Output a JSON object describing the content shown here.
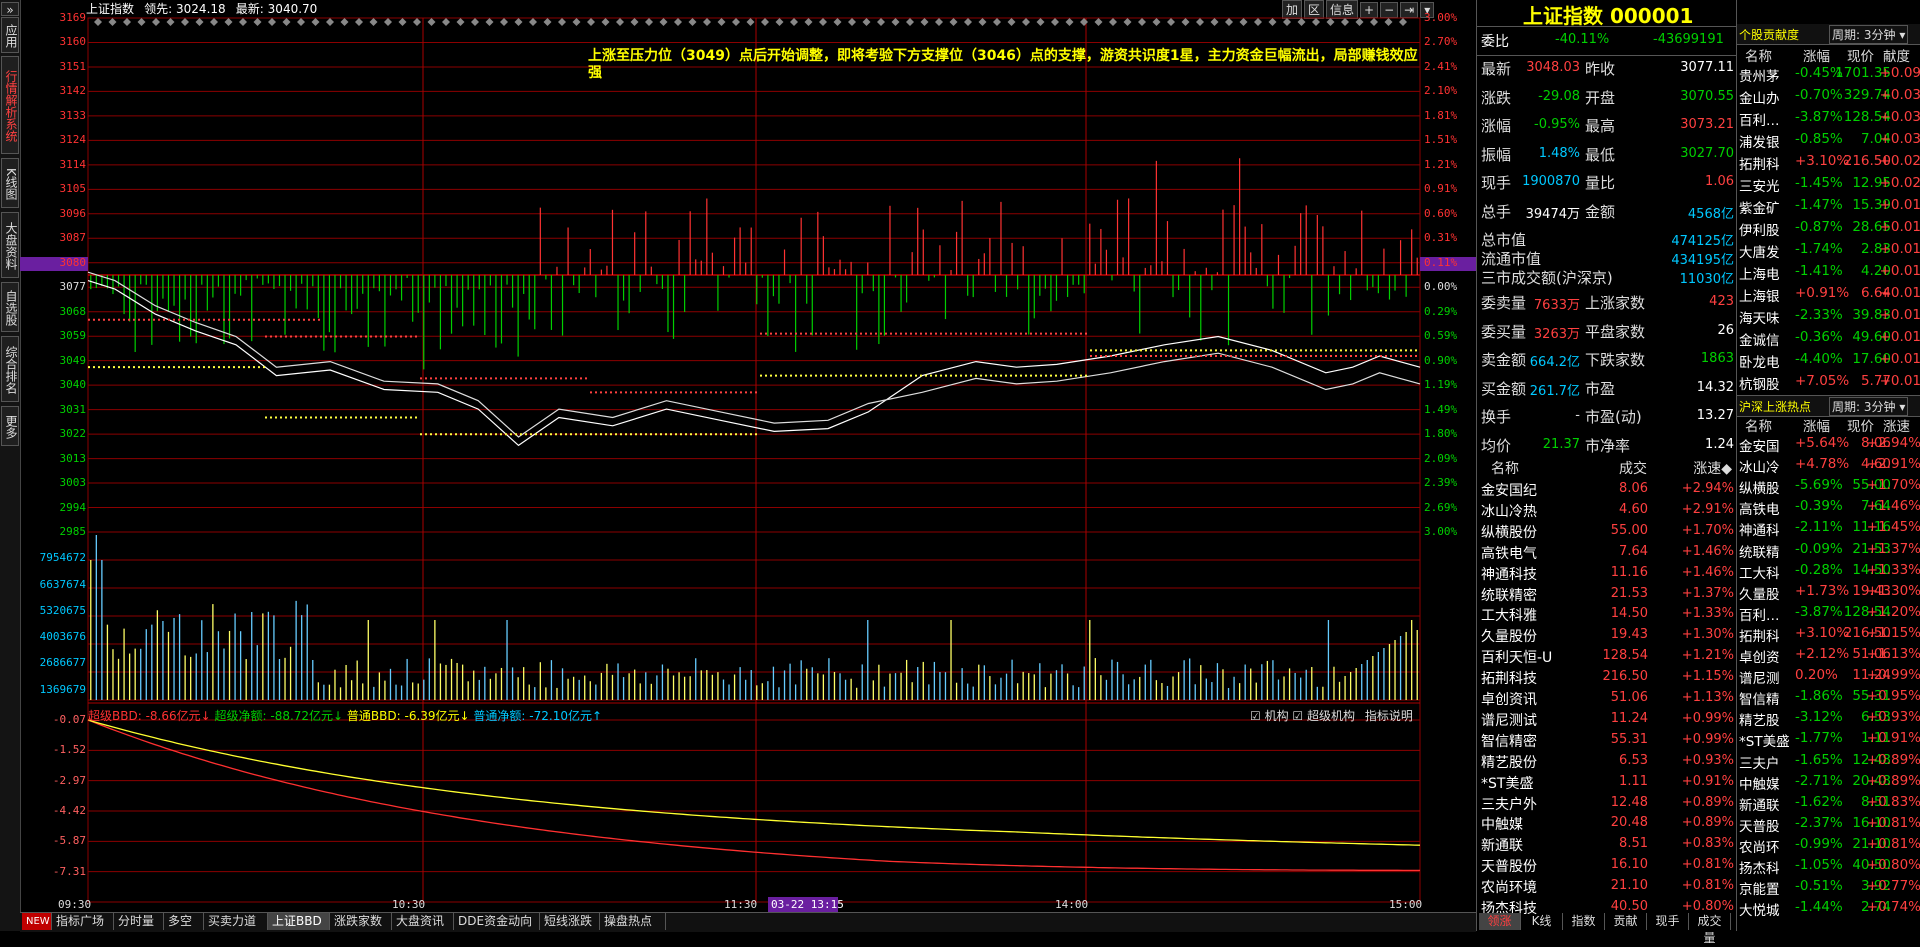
{
  "left_tabs": [
    "应用",
    "行情解析系统",
    "K线图",
    "大盘资料",
    "自选股",
    "综合排名",
    "更多"
  ],
  "header": {
    "index_name": "上证指数",
    "lead_label": "领先:",
    "lead_value": "3024.18",
    "latest_label": "最新:",
    "latest_value": "3040.70",
    "buttons": [
      "加",
      "区",
      "信息",
      "+",
      "−",
      "⇥",
      "▾"
    ]
  },
  "annotation": "上涨至压力位（3049）点后开始调整，即将考验下方支撑位（3046）点的支撑，游资共识度1星，主力资金巨幅流出，局部赚钱效应强",
  "price_axis": {
    "left": [
      "3169",
      "3160",
      "3151",
      "3142",
      "3133",
      "3124",
      "3114",
      "3105",
      "3096",
      "3087",
      "3080",
      "3077",
      "3068",
      "3059",
      "3049",
      "3040",
      "3031",
      "3022",
      "3013",
      "3003",
      "2994",
      "2985"
    ],
    "right": [
      "3.00%",
      "2.70%",
      "2.41%",
      "2.10%",
      "1.81%",
      "1.51%",
      "1.21%",
      "0.91%",
      "0.60%",
      "0.31%",
      "0.11%",
      "0.00%",
      "0.29%",
      "0.59%",
      "0.90%",
      "1.19%",
      "1.49%",
      "1.80%",
      "2.09%",
      "2.39%",
      "2.69%",
      "3.00%"
    ]
  },
  "volume_axis": [
    "7954672",
    "6637674",
    "5320675",
    "4003676",
    "2686677",
    "1369679"
  ],
  "bbd_legend": {
    "super_bbd": "超级BBD: -8.66亿元",
    "super_net": "超级净额: -88.72亿元",
    "normal_bbd": "普通BBD: -6.39亿元",
    "normal_net": "普通净额: -72.10亿元",
    "check1": "机构",
    "check2": "超级机构",
    "explain": "指标说明"
  },
  "bbd_axis": [
    "-0.07",
    "-1.52",
    "-2.97",
    "-4.42",
    "-5.87",
    "-7.31"
  ],
  "time_axis": [
    "09:30",
    "10:30",
    "11:30",
    "13:15",
    "14:00",
    "15:00"
  ],
  "date_badge": "03-22 13:15",
  "bottom_tabs": [
    "NEW",
    "指标广场",
    "分时量",
    "多空",
    "买卖力道",
    "上证BBD",
    "涨跌家数",
    "大盘资讯",
    "DDE资金动向",
    "短线涨跌",
    "操盘热点"
  ],
  "quote": {
    "title": "上证指数 000001",
    "weibi_label": "委比",
    "weibi_value": "-40.11%",
    "weicha_value": "-43699191",
    "rows": [
      [
        "最新",
        "3048.03",
        "昨收",
        "3077.11"
      ],
      [
        "涨跌",
        "-29.08",
        "开盘",
        "3070.55"
      ],
      [
        "涨幅",
        "-0.95%",
        "最高",
        "3073.21"
      ],
      [
        "振幅",
        "1.48%",
        "最低",
        "3027.70"
      ],
      [
        "现手",
        "1900870",
        "量比",
        "1.06"
      ],
      [
        "总手",
        "39474万",
        "金额",
        "4568亿"
      ]
    ],
    "mkt": [
      [
        "总市值",
        "474125亿"
      ],
      [
        "流通市值",
        "434195亿"
      ],
      [
        "三市成交额(沪深京)",
        "11030亿"
      ]
    ],
    "rows2": [
      [
        "委卖量",
        "7633万",
        "上涨家数",
        "423"
      ],
      [
        "委买量",
        "3263万",
        "平盘家数",
        "26"
      ],
      [
        "卖金额",
        "664.2亿",
        "下跌家数",
        "1863"
      ],
      [
        "买金额",
        "261.7亿",
        "市盈",
        "14.32"
      ],
      [
        "换手",
        "-",
        "市盈(动)",
        "13.27"
      ],
      [
        "均价",
        "21.37",
        "市净率",
        "1.24"
      ]
    ],
    "list_header": [
      "名称",
      "成交",
      "涨速"
    ],
    "list": [
      [
        "金安国纪",
        "8.06",
        "+2.94%"
      ],
      [
        "冰山冷热",
        "4.60",
        "+2.91%"
      ],
      [
        "纵横股份",
        "55.00",
        "+1.70%"
      ],
      [
        "高铁电气",
        "7.64",
        "+1.46%"
      ],
      [
        "神通科技",
        "11.16",
        "+1.46%"
      ],
      [
        "统联精密",
        "21.53",
        "+1.37%"
      ],
      [
        "工大科雅",
        "14.50",
        "+1.33%"
      ],
      [
        "久量股份",
        "19.43",
        "+1.30%"
      ],
      [
        "百利天恒-U",
        "128.54",
        "+1.21%"
      ],
      [
        "拓荆科技",
        "216.50",
        "+1.15%"
      ],
      [
        "卓创资讯",
        "51.06",
        "+1.13%"
      ],
      [
        "谱尼测试",
        "11.24",
        "+0.99%"
      ],
      [
        "智信精密",
        "55.31",
        "+0.99%"
      ],
      [
        "精艺股份",
        "6.53",
        "+0.93%"
      ],
      [
        "*ST美盛",
        "1.11",
        "+0.91%"
      ],
      [
        "三夫户外",
        "12.48",
        "+0.89%"
      ],
      [
        "中触媒",
        "20.48",
        "+0.89%"
      ],
      [
        "新通联",
        "8.51",
        "+0.83%"
      ],
      [
        "天普股份",
        "16.10",
        "+0.81%"
      ],
      [
        "农尚环境",
        "21.10",
        "+0.81%"
      ],
      [
        "扬杰科技",
        "40.50",
        "+0.80%"
      ]
    ],
    "tabs": [
      "领涨",
      "K线",
      "指数",
      "贡献",
      "现手",
      "成交量"
    ]
  },
  "contrib": {
    "title": "个股贡献度",
    "period": "周期: 3分钟",
    "header": [
      "名称",
      "涨幅",
      "现价",
      "献度"
    ],
    "rows": [
      [
        "贵州茅",
        "-0.45%",
        "1701.35",
        "+0.09"
      ],
      [
        "金山办",
        "-0.70%",
        "329.74",
        "+0.03"
      ],
      [
        "百利…",
        "-3.87%",
        "128.54",
        "+0.03"
      ],
      [
        "浦发银",
        "-0.85%",
        "7.04",
        "+0.03"
      ],
      [
        "拓荆科",
        "+3.10%",
        "216.50",
        "+0.02"
      ],
      [
        "三安光",
        "-1.45%",
        "12.95",
        "+0.02"
      ],
      [
        "紫金矿",
        "-1.47%",
        "15.39",
        "+0.01"
      ],
      [
        "伊利股",
        "-0.87%",
        "28.65",
        "+0.01"
      ],
      [
        "大唐发",
        "-1.74%",
        "2.83",
        "+0.01"
      ],
      [
        "上海电",
        "-1.41%",
        "4.20",
        "+0.01"
      ],
      [
        "上海银",
        "+0.91%",
        "6.64",
        "+0.01"
      ],
      [
        "海天味",
        "-2.33%",
        "39.83",
        "+0.01"
      ],
      [
        "金诚信",
        "-0.36%",
        "49.60",
        "+0.01"
      ],
      [
        "卧龙电",
        "-4.40%",
        "17.60",
        "+0.01"
      ],
      [
        "杭钢股",
        "+7.05%",
        "5.77",
        "+0.01"
      ]
    ]
  },
  "hot": {
    "title": "沪深上涨热点",
    "period": "周期: 3分钟",
    "header": [
      "名称",
      "涨幅",
      "现价",
      "涨速"
    ],
    "rows": [
      [
        "金安国",
        "+5.64%",
        "8.06",
        "+2.94%"
      ],
      [
        "冰山冷",
        "+4.78%",
        "4.60",
        "+2.91%"
      ],
      [
        "纵横股",
        "-5.69%",
        "55.00",
        "+1.70%"
      ],
      [
        "高铁电",
        "-0.39%",
        "7.64",
        "+1.46%"
      ],
      [
        "神通科",
        "-2.11%",
        "11.16",
        "+1.45%"
      ],
      [
        "统联精",
        "-0.09%",
        "21.53",
        "+1.37%"
      ],
      [
        "工大科",
        "-0.28%",
        "14.50",
        "+1.33%"
      ],
      [
        "久量股",
        "+1.73%",
        "19.43",
        "+1.30%"
      ],
      [
        "百利…",
        "-3.87%",
        "128.54",
        "+1.20%"
      ],
      [
        "拓荆科",
        "+3.10%",
        "216.50",
        "+1.15%"
      ],
      [
        "卓创资",
        "+2.12%",
        "51.06",
        "+1.13%"
      ],
      [
        "谱尼测",
        "0.20%",
        "11.24",
        "+0.99%"
      ],
      [
        "智信精",
        "-1.86%",
        "55.31",
        "+0.95%"
      ],
      [
        "精艺股",
        "-3.12%",
        "6.53",
        "+0.93%"
      ],
      [
        "*ST美盛",
        "-1.77%",
        "1.11",
        "+0.91%"
      ],
      [
        "三夫户",
        "-1.65%",
        "12.48",
        "+0.89%"
      ],
      [
        "中触媒",
        "-2.71%",
        "20.48",
        "+0.89%"
      ],
      [
        "新通联",
        "-1.62%",
        "8.51",
        "+0.83%"
      ],
      [
        "天普股",
        "-2.37%",
        "16.10",
        "+0.81%"
      ],
      [
        "农尚环",
        "-0.99%",
        "21.10",
        "+0.81%"
      ],
      [
        "扬杰科",
        "-1.05%",
        "40.50",
        "+0.80%"
      ],
      [
        "京能置",
        "-0.51%",
        "3.92",
        "+0.77%"
      ],
      [
        "大悦城",
        "-1.44%",
        "2.74",
        "+0.74%"
      ]
    ]
  },
  "colors": {
    "up": "#ff3232",
    "down": "#00d000",
    "grid": "#8b0000",
    "price": "#ffffff",
    "avg": "#ffff00"
  }
}
